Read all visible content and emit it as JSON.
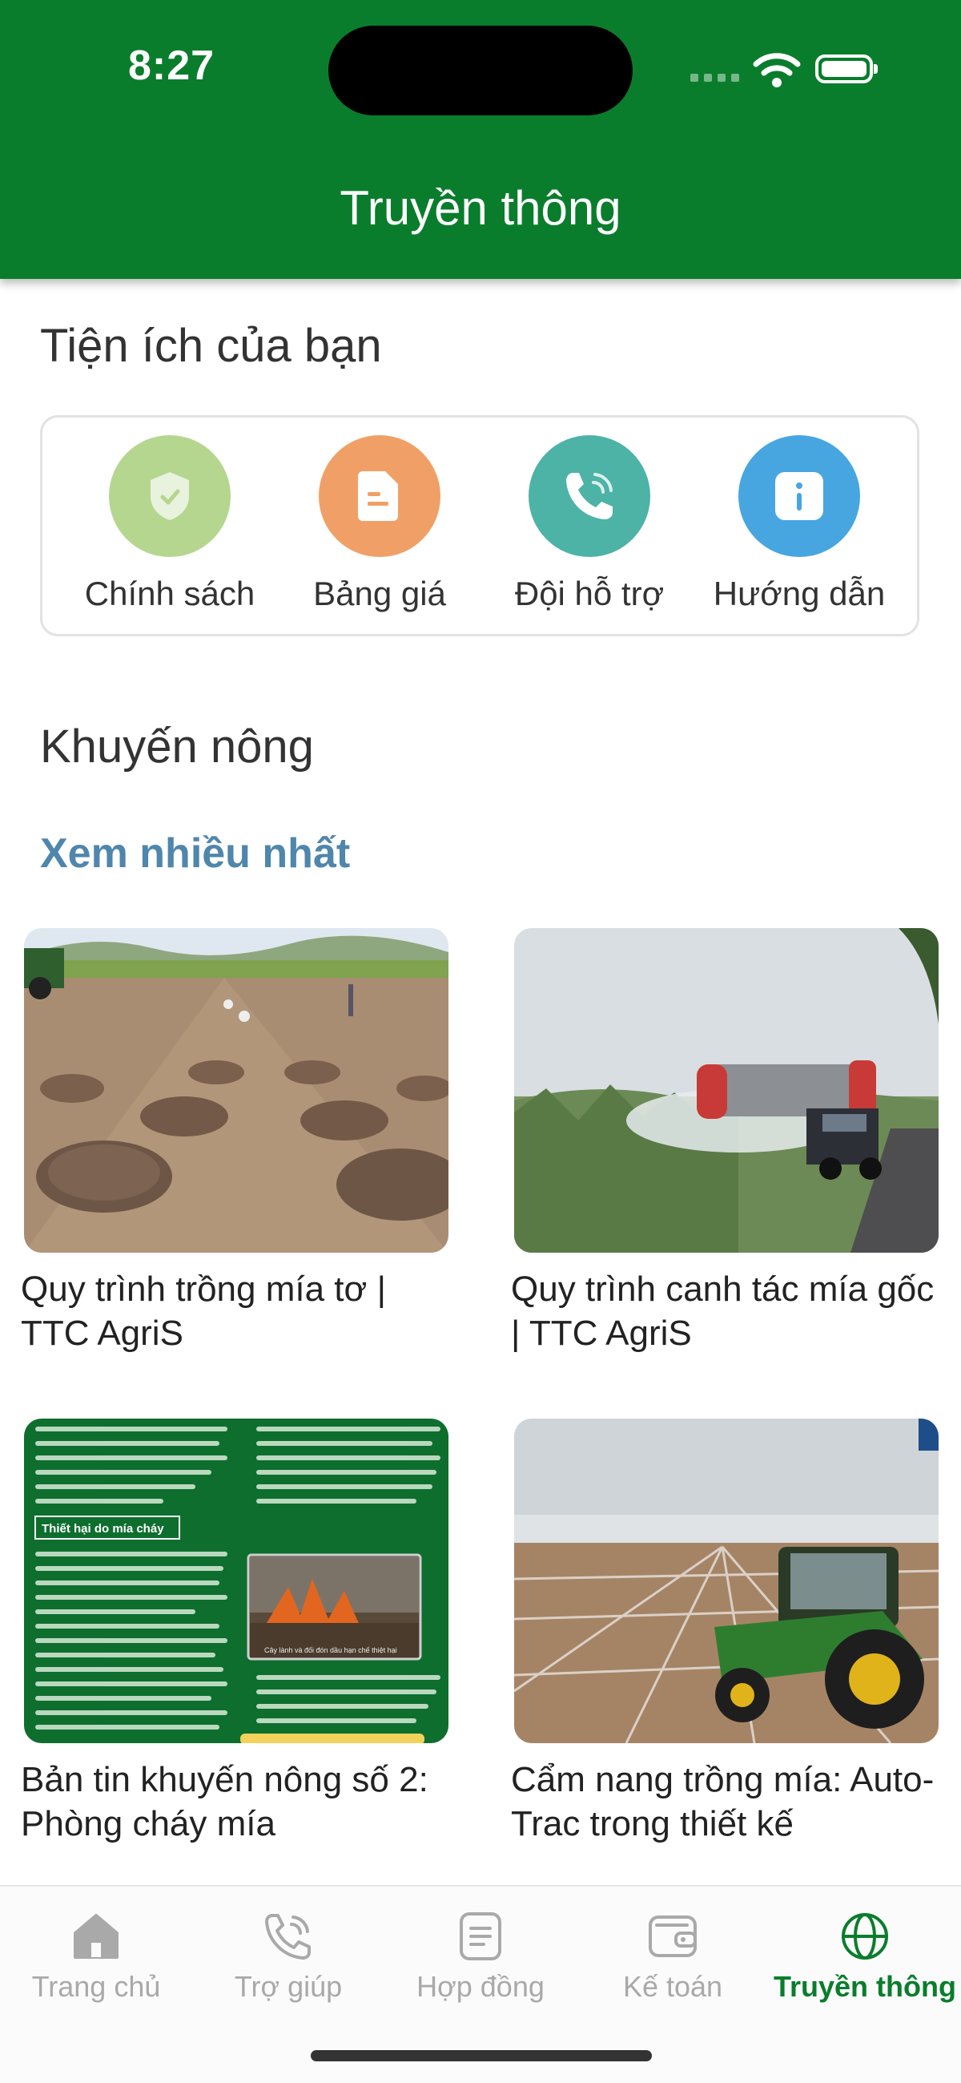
{
  "status_bar": {
    "time": "8:27"
  },
  "header": {
    "title": "Truyền thông"
  },
  "utilities": {
    "title": "Tiện ích của bạn",
    "items": [
      {
        "label": "Chính sách",
        "icon": "shield-check-icon",
        "color": "#b5d68f"
      },
      {
        "label": "Bảng giá",
        "icon": "document-icon",
        "color": "#f0a066"
      },
      {
        "label": "Đội hỗ trợ",
        "icon": "phone-icon",
        "color": "#4cb3a6"
      },
      {
        "label": "Hướng dẫn",
        "icon": "info-icon",
        "color": "#47a6e0"
      }
    ]
  },
  "extension": {
    "title": "Khuyến nông",
    "subtitle": "Xem nhiều nhất",
    "articles": [
      {
        "title": "Quy trình trồng mía tơ | TTC AgriS"
      },
      {
        "title": "Quy trình canh tác mía gốc | TTC AgriS"
      },
      {
        "title": "Bản tin khuyến nông số 2: Phòng cháy mía"
      },
      {
        "title": "Cẩm nang trồng mía: Auto-Trac trong thiết kế"
      }
    ],
    "bulletin_heading": "Thiết hại do mía cháy",
    "bulletin_caption": "Cây lành và đối đón dầu hạn chế thiệt hại"
  },
  "tabbar": {
    "items": [
      {
        "label": "Trang chủ",
        "icon": "home-icon",
        "active": false
      },
      {
        "label": "Trợ giúp",
        "icon": "phone-help-icon",
        "active": false
      },
      {
        "label": "Hợp đồng",
        "icon": "contract-icon",
        "active": false
      },
      {
        "label": "Kế toán",
        "icon": "wallet-icon",
        "active": false
      },
      {
        "label": "Truyền thông",
        "icon": "globe-icon",
        "active": true
      }
    ],
    "active_color": "#0a7d2c"
  },
  "colors": {
    "brand": "#0a7d2c",
    "subtitle": "#4f86ac"
  }
}
